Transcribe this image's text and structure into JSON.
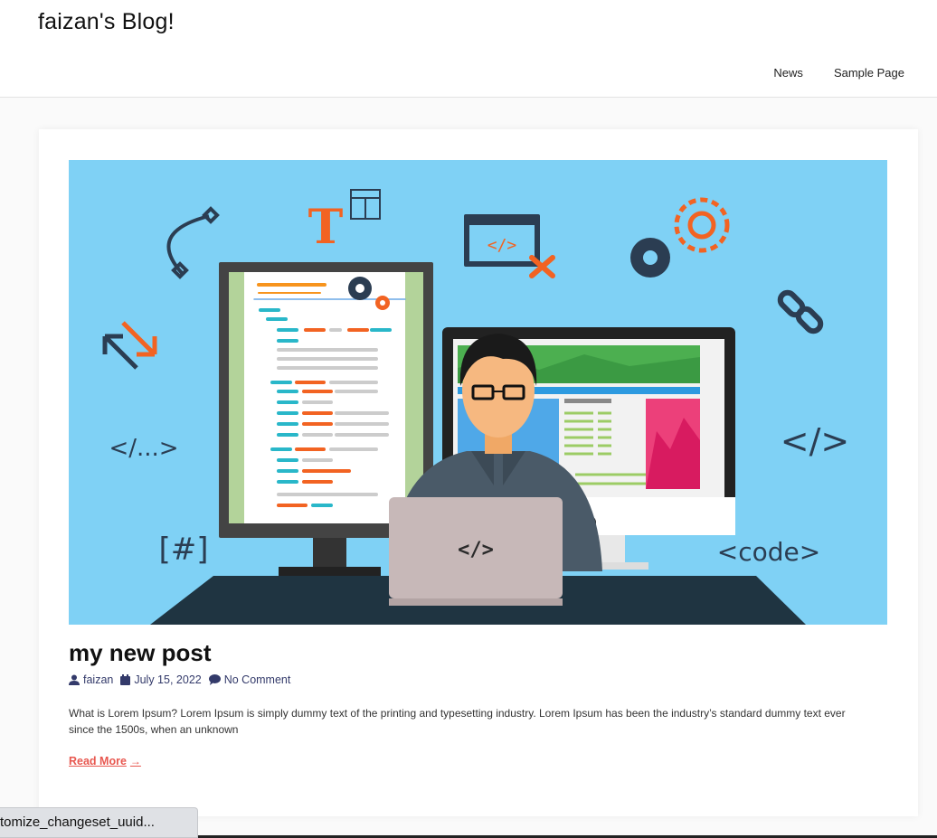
{
  "site": {
    "title": "faizan's Blog!"
  },
  "nav": {
    "items": [
      {
        "label": "News"
      },
      {
        "label": "Sample Page"
      }
    ]
  },
  "hero": {
    "left_code_tag": "</...>",
    "right_code_tag": "</>",
    "hash_tag": "[#]",
    "code_word": "<code>",
    "laptop_code": "</>",
    "mini_code": "</>",
    "big_t": "T"
  },
  "post": {
    "title": "my new post",
    "author": "faizan",
    "date": "July 15, 2022",
    "comments": "No Comment",
    "excerpt": "What is Lorem Ipsum? Lorem Ipsum is simply dummy text of the printing and typesetting industry. Lorem Ipsum has been the industry’s standard dummy text ever since the 1500s, when an unknown",
    "read_more": "Read More",
    "read_more_arrow": "→"
  },
  "status_bar": {
    "text": "tomize_changeset_uuid..."
  },
  "colors": {
    "hero_bg": "#7fd1f5",
    "accent": "#e8574f",
    "meta": "#333a6a",
    "orange": "#f26322",
    "navy": "#2b3d52"
  }
}
